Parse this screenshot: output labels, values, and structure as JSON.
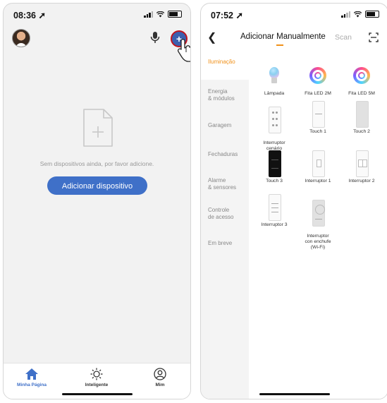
{
  "left": {
    "status": {
      "time": "08:36 ➚"
    },
    "empty_message": "Sem dispositivos ainda, por favor adicione.",
    "add_button": "Adicionar dispositivo",
    "tabs": [
      {
        "label": "Minha Página",
        "icon": "home-icon",
        "active": true
      },
      {
        "label": "Inteligente",
        "icon": "sun-icon",
        "active": false
      },
      {
        "label": "Mim",
        "icon": "user-icon",
        "active": false
      }
    ]
  },
  "right": {
    "status": {
      "time": "07:52 ➚"
    },
    "title": "Adicionar Manualmente",
    "scan": "Scan",
    "categories": [
      {
        "label": "Iluminação",
        "active": true
      },
      {
        "label": "Energia\n& módulos"
      },
      {
        "label": "Garagem"
      },
      {
        "label": "Fechaduras"
      },
      {
        "label": "Alarme\n& sensores"
      },
      {
        "label": "Controle\nde acesso"
      },
      {
        "label": "Em breve"
      }
    ],
    "devices": [
      {
        "label": "Lâmpada",
        "icon": "bulb-icon"
      },
      {
        "label": "Fita LED 2M",
        "icon": "led-ring-icon"
      },
      {
        "label": "Fita LED 5M",
        "icon": "led-ring-icon"
      },
      {
        "label": "Interruptor\ncenário",
        "icon": "scene-switch-icon"
      },
      {
        "label": "Touch 1",
        "icon": "touch-switch-icon"
      },
      {
        "label": "Touch 2",
        "icon": "touch-switch-gray-icon"
      },
      {
        "label": "Touch 3",
        "icon": "touch-switch-black-icon"
      },
      {
        "label": "Interruptor 1",
        "icon": "switch-1-icon"
      },
      {
        "label": "Interruptor 2",
        "icon": "switch-2-icon"
      },
      {
        "label": "Interruptor 3",
        "icon": "switch-3-icon"
      },
      {
        "label": "Interruptor\ncon enchufe\n(Wi-Fi)",
        "icon": "socket-switch-icon"
      }
    ]
  },
  "colors": {
    "accent_blue": "#3f70c8",
    "accent_orange": "#f0911a",
    "highlight_red": "#c0141e"
  }
}
